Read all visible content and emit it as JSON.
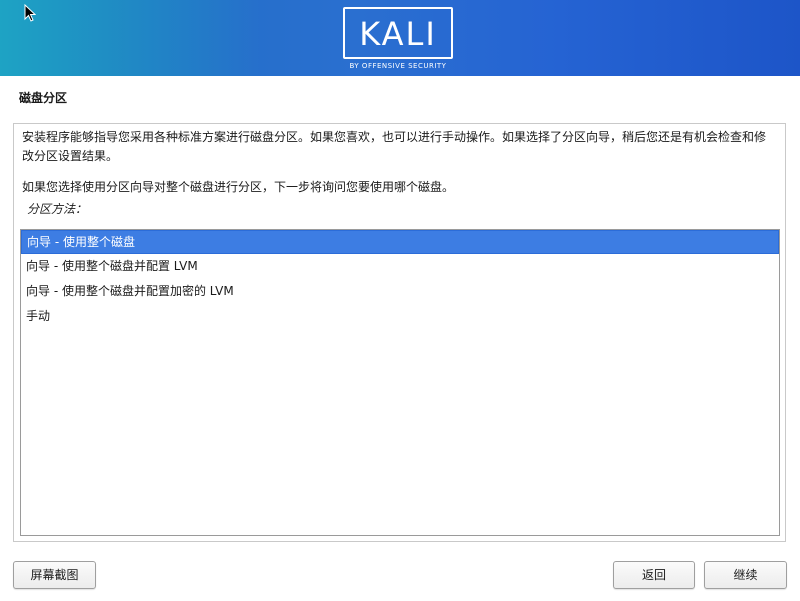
{
  "banner": {
    "logo_text": "KALI",
    "logo_subtitle": "BY OFFENSIVE SECURITY",
    "colors": {
      "left": "#1ea3c4",
      "mid": "#2a6fd0",
      "right": "#1d55c8"
    }
  },
  "page": {
    "title": "磁盘分区",
    "description": "安装程序能够指导您采用各种标准方案进行磁盘分区。如果您喜欢，也可以进行手动操作。如果选择了分区向导，稍后您还是有机会检查和修改分区设置结果。",
    "description2": "如果您选择使用分区向导对整个磁盘进行分区，下一步将询问您要使用哪个磁盘。",
    "method_label": "分区方法："
  },
  "methods": [
    {
      "label": "向导 - 使用整个磁盘",
      "selected": true
    },
    {
      "label": "向导 - 使用整个磁盘并配置 LVM",
      "selected": false
    },
    {
      "label": "向导 - 使用整个磁盘并配置加密的 LVM",
      "selected": false
    },
    {
      "label": "手动",
      "selected": false
    }
  ],
  "buttons": {
    "screenshot": "屏幕截图",
    "back": "返回",
    "continue": "继续"
  },
  "colors": {
    "selection": "#3d7de3"
  }
}
